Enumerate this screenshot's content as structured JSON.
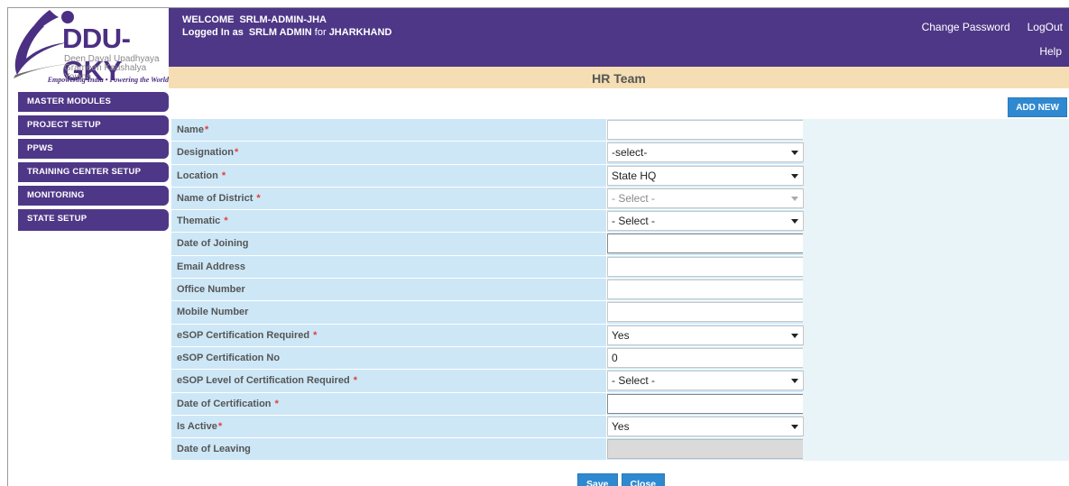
{
  "logo": {
    "title": "DDU-GKY",
    "sub1": "Deen Dayal Upadhyaya",
    "sub2": "Grameen Kaushalya Yojana",
    "tagline": "Empowering India • Powering the World"
  },
  "header": {
    "welcome_label": "WELCOME",
    "welcome_user": "SRLM-ADMIN-JHA",
    "logged_label": "Logged In as",
    "logged_user": "SRLM ADMIN",
    "for_label": "for",
    "state": "JHARKHAND",
    "change_password": "Change Password",
    "logout": "LogOut",
    "help": "Help"
  },
  "page_title": "HR Team",
  "sidebar": {
    "items": [
      {
        "label": "MASTER MODULES"
      },
      {
        "label": "PROJECT SETUP"
      },
      {
        "label": "PPWS"
      },
      {
        "label": "TRAINING CENTER SETUP"
      },
      {
        "label": "MONITORING"
      },
      {
        "label": "STATE SETUP"
      }
    ]
  },
  "add_new": "ADD NEW",
  "form": {
    "rows": [
      {
        "label": "Name",
        "required": "*",
        "value": ""
      },
      {
        "label": "Designation",
        "required": "*",
        "value": "-select-"
      },
      {
        "label": "Location ",
        "required": "*",
        "value": "State HQ"
      },
      {
        "label": "Name of District ",
        "required": "*",
        "value": "- Select -"
      },
      {
        "label": "Thematic ",
        "required": "*",
        "value": "- Select -"
      },
      {
        "label": "Date of Joining",
        "required": "",
        "value": ""
      },
      {
        "label": "Email Address",
        "required": "",
        "value": ""
      },
      {
        "label": "Office Number",
        "required": "",
        "value": ""
      },
      {
        "label": "Mobile Number",
        "required": "",
        "value": ""
      },
      {
        "label": "eSOP Certification Required ",
        "required": "*",
        "value": "Yes"
      },
      {
        "label": "eSOP Certification No",
        "required": "",
        "value": "0"
      },
      {
        "label": "eSOP Level of Certification Required ",
        "required": "*",
        "value": "- Select -"
      },
      {
        "label": "Date of Certification ",
        "required": "*",
        "value": ""
      },
      {
        "label": "Is Active",
        "required": "*",
        "value": "Yes"
      },
      {
        "label": "Date of Leaving",
        "required": "",
        "value": ""
      }
    ]
  },
  "buttons": {
    "save": "Save",
    "close": "Close"
  }
}
